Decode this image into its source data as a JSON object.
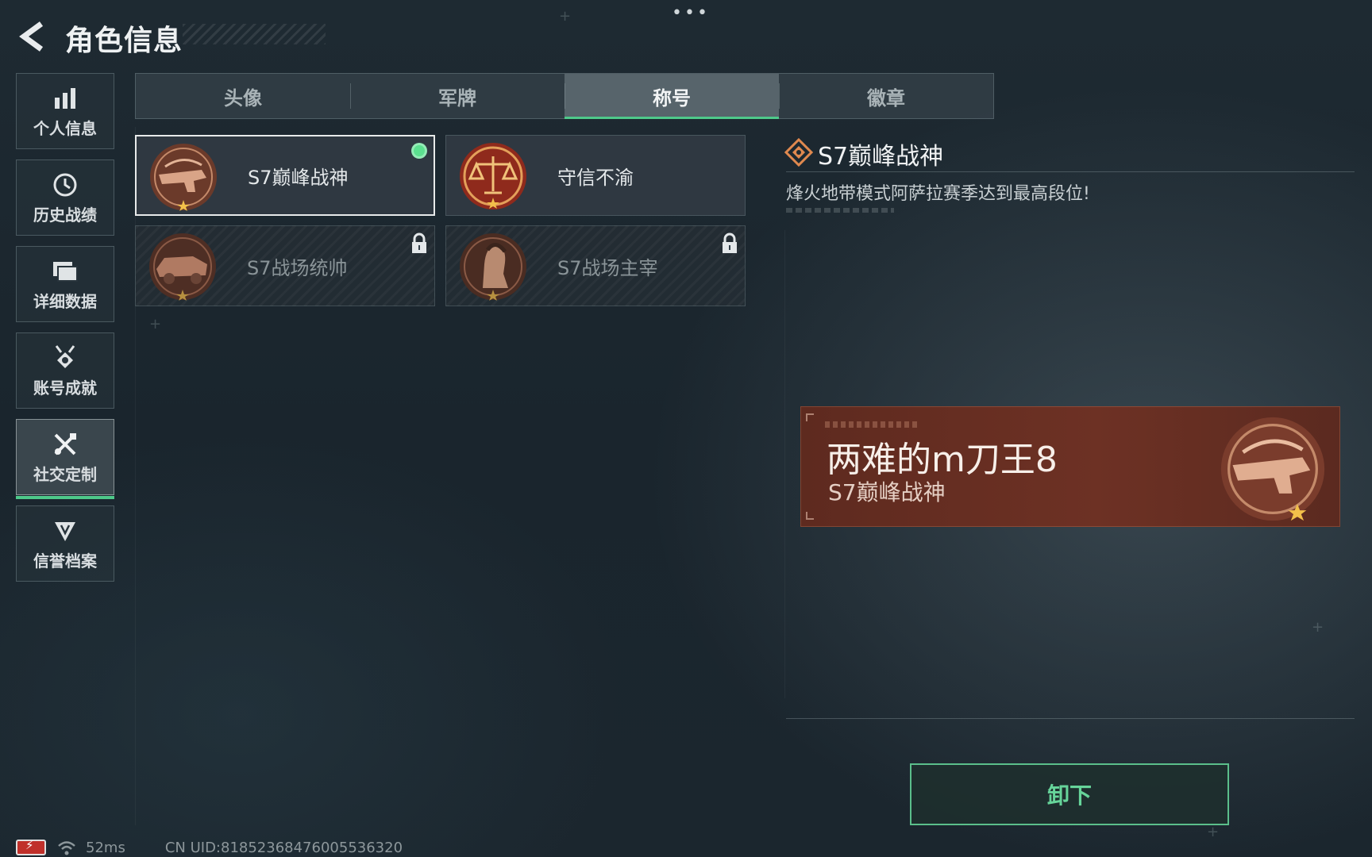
{
  "header": {
    "title": "角色信息",
    "menu_dots": "•••"
  },
  "sidebar": {
    "items": [
      {
        "label": "个人信息",
        "icon": "bar-chart-icon",
        "active": false
      },
      {
        "label": "历史战绩",
        "icon": "clock-icon",
        "active": false
      },
      {
        "label": "详细数据",
        "icon": "folder-icon",
        "active": false
      },
      {
        "label": "账号成就",
        "icon": "medal-icon",
        "active": false
      },
      {
        "label": "社交定制",
        "icon": "tools-icon",
        "active": true
      },
      {
        "label": "信誉档案",
        "icon": "shield-icon",
        "active": false
      }
    ]
  },
  "tabs": [
    {
      "label": "头像",
      "active": false
    },
    {
      "label": "军牌",
      "active": false
    },
    {
      "label": "称号",
      "active": true
    },
    {
      "label": "徽章",
      "active": false
    }
  ],
  "titles": [
    {
      "label": "S7巅峰战神",
      "emblem": "weapon-emblem",
      "selected": true,
      "equipped": true,
      "locked": false
    },
    {
      "label": "守信不渝",
      "emblem": "scales-emblem",
      "selected": false,
      "equipped": false,
      "locked": false
    },
    {
      "label": "S7战场统帅",
      "emblem": "vehicle-emblem",
      "selected": false,
      "equipped": false,
      "locked": true
    },
    {
      "label": "S7战场主宰",
      "emblem": "soldier-emblem",
      "selected": false,
      "equipped": false,
      "locked": true
    }
  ],
  "detail": {
    "title": "S7巅峰战神",
    "description": "烽火地带模式阿萨拉赛季达到最高段位!"
  },
  "preview": {
    "player_name": "两难的m刀王8",
    "title": "S7巅峰战神"
  },
  "action": {
    "unequip_label": "卸下"
  },
  "footer": {
    "ping": "52ms",
    "uid": "CN UID:81852368476005536320"
  },
  "colors": {
    "accent_green": "#4ec98a",
    "preview_bg": "#6d3124",
    "emblem_bronze": "#8a4a33"
  }
}
